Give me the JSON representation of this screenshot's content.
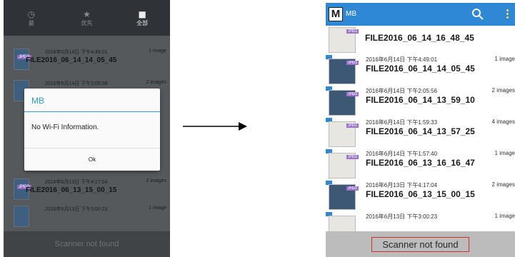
{
  "left_screen": {
    "tabs": [
      {
        "icon": "clock-icon",
        "label": "最",
        "glyph": "◷"
      },
      {
        "icon": "star-icon",
        "label": "优先",
        "glyph": "★"
      },
      {
        "icon": "tag-icon",
        "label": "全部",
        "glyph": "■"
      }
    ],
    "rows": [
      {
        "meta_date": "2016年6月14日 下午4:49:01",
        "meta_count": "1 image",
        "name": "FILE2016_06_14_14_05_45",
        "tag": "JPEG"
      },
      {
        "meta_date": "2016年6月14日 下午2:05:56",
        "meta_count": "2 images",
        "name": "",
        "tag": ""
      },
      {
        "meta_date": "2016年6月13日 下午4:17:04",
        "meta_count": "2 images",
        "name": "FILE2016_06_13_15_00_15",
        "tag": "JPEG"
      },
      {
        "meta_date": "2016年6月13日 下午3:00:23",
        "meta_count": "1 image",
        "name": "",
        "tag": ""
      }
    ],
    "dialog": {
      "title": "MB",
      "message": "No Wi-Fi Information.",
      "ok_label": "Ok"
    },
    "scanner_label": "Scanner not found"
  },
  "right_screen": {
    "logo_letter": "M",
    "app_title": "MB",
    "first_file": "FILE2016_06_14_16_48_45",
    "first_tag": "JPEG",
    "rows": [
      {
        "meta_date": "2016年6月14日 下午4:49:01",
        "meta_count": "1 image",
        "name": "FILE2016_06_14_14_05_45",
        "tag": "JPEG"
      },
      {
        "meta_date": "2016年6月14日 下午2:05:56",
        "meta_count": "2 images",
        "name": "FILE2016_06_14_13_59_10",
        "tag": "JPEG"
      },
      {
        "meta_date": "2016年6月14日 下午1:59:33",
        "meta_count": "4 images",
        "name": "FILE2016_06_14_13_57_25",
        "tag": "JPEG"
      },
      {
        "meta_date": "2016年6月14日 下午1:57:40",
        "meta_count": "1 image",
        "name": "FILE2016_06_13_16_16_47",
        "tag": "JPEG"
      },
      {
        "meta_date": "2016年6月13日 下午4:17:04",
        "meta_count": "2 images",
        "name": "FILE2016_06_13_15_00_15",
        "tag": "JPEG"
      },
      {
        "meta_date": "2016年6月13日 下午3:00:23",
        "meta_count": "1 image",
        "name": "",
        "tag": ""
      }
    ],
    "scanner_label": "Scanner not found"
  },
  "colors": {
    "appbar": "#2e88d6",
    "dialog_accent": "#2f9fd8",
    "scanner_outline": "#d22f2f",
    "jpeg_tag": "#9b73c9"
  }
}
